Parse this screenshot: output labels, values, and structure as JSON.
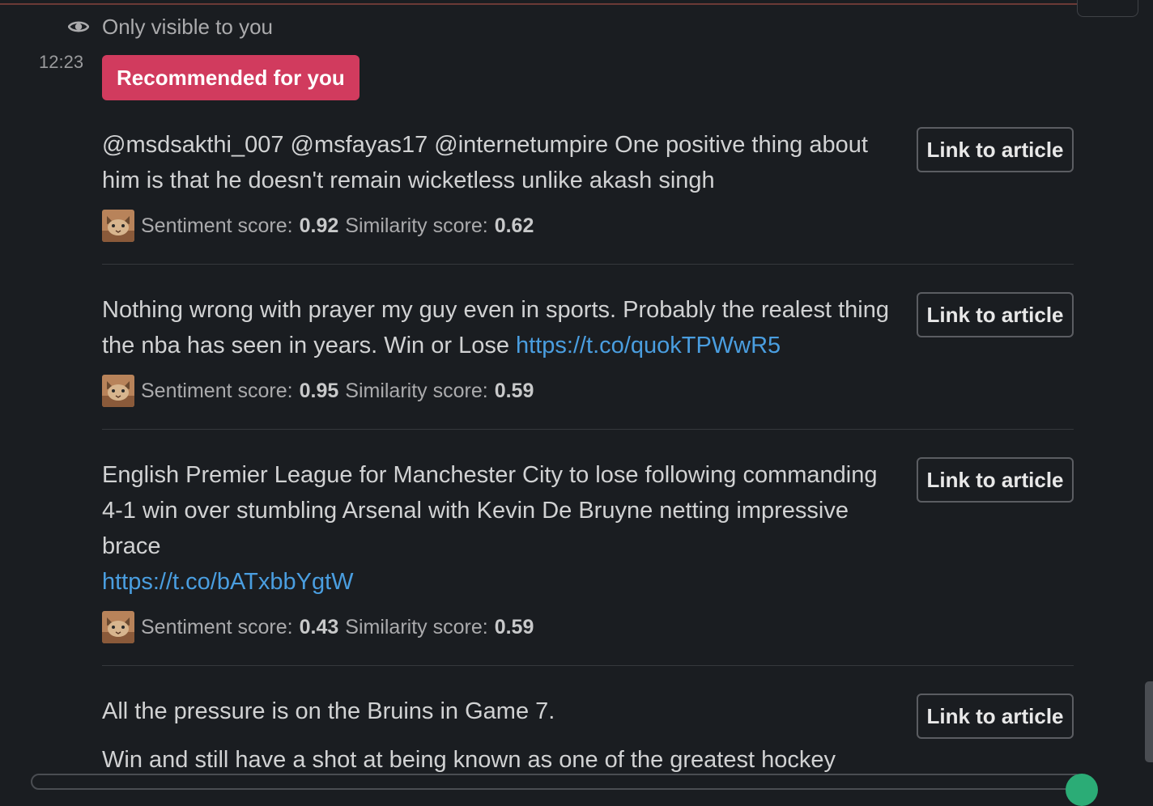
{
  "header": {
    "visibility_label": "Only visible to you",
    "timestamp": "12:23",
    "badge": "Recommended for you"
  },
  "items": [
    {
      "text": "@msdsakthi_007 @msfayas17 @internetumpire One positive thing about him is that he doesn't remain wicketless unlike akash singh",
      "link": "",
      "button": "Link to article",
      "sentiment_label": "Sentiment score:",
      "sentiment": "0.92",
      "similarity_label": "Similarity score:",
      "similarity": "0.62"
    },
    {
      "text": "Nothing wrong with prayer my guy even in sports. Probably the realest thing the nba has seen in years. Win or Lose ",
      "link": "https://t.co/quokTPWwR5",
      "button": "Link to article",
      "sentiment_label": "Sentiment score:",
      "sentiment": "0.95",
      "similarity_label": "Similarity score:",
      "similarity": "0.59"
    },
    {
      "text": "English Premier League for Manchester City to lose following commanding 4-1 win over stumbling Arsenal with Kevin De Bruyne netting impressive brace",
      "link": "https://t.co/bATxbbYgtW",
      "button": "Link to article",
      "sentiment_label": "Sentiment score:",
      "sentiment": "0.43",
      "similarity_label": "Similarity score:",
      "similarity": "0.59"
    },
    {
      "text": "All the pressure is on the Bruins in Game 7.",
      "text2": "Win and still have a shot at being known as one of the greatest hockey",
      "button": "Link to article"
    }
  ],
  "colors": {
    "background": "#1a1d21",
    "badge": "#d13b5e",
    "link": "#4a9ee0"
  },
  "icons": {
    "visibility": "eye-icon",
    "avatar": "cat-avatar-icon"
  }
}
